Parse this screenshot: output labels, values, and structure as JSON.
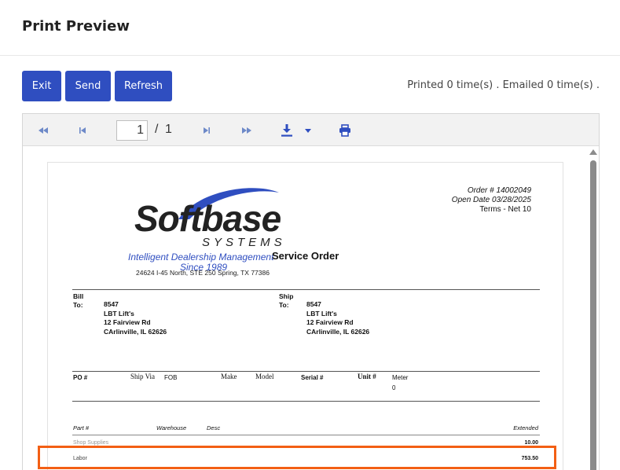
{
  "header": {
    "title": "Print Preview"
  },
  "actions": {
    "exit_label": "Exit",
    "send_label": "Send",
    "refresh_label": "Refresh"
  },
  "status": {
    "text": "Printed 0 time(s) . Emailed 0 time(s) ."
  },
  "viewer": {
    "current_page": "1",
    "separator": "/",
    "total_pages": "1",
    "icons": [
      "first-page-icon",
      "previous-page-icon",
      "next-page-icon",
      "last-page-icon",
      "download-icon",
      "dropdown-arrow-icon",
      "printer-icon"
    ]
  },
  "document": {
    "logo_text": "Softbase",
    "logo_sub": "SYSTEMS",
    "logo_tagline": "Intelligent Dealership Management",
    "logo_since": "Since 1989",
    "company_address": "24624 I-45 North, STE 250 Spring, TX 77386",
    "doc_title": "Service Order",
    "order_number": "Order # 14002049",
    "open_date": "Open Date 03/28/2025",
    "terms": "Terms - Net 10",
    "bill_label_1": "Bill",
    "bill_label_2": "To:",
    "bill_to": {
      "id": "8547",
      "name": "LBT Lift's",
      "street": "12 Fairview Rd",
      "city": "CArlinville, IL 62626"
    },
    "ship_label_1": "Ship",
    "ship_label_2": "To:",
    "ship_to": {
      "id": "8547",
      "name": "LBT Lift's",
      "street": "12 Fairview Rd",
      "city": "CArlinville, IL 62626"
    },
    "headers": {
      "po": "PO #",
      "ship_via": "Ship Via",
      "fob": "FOB",
      "make": "Make",
      "model": "Model",
      "serial": "Serial #",
      "unit": "Unit #",
      "meter": "Meter",
      "meter_value": "0"
    },
    "line_headers": {
      "part": "Part #",
      "warehouse": "Warehouse",
      "desc": "Desc",
      "extended": "Extended"
    },
    "lines": [
      {
        "desc": "Shop Supplies",
        "extended": "10.00"
      },
      {
        "desc": "Labor",
        "extended": "753.50"
      }
    ]
  },
  "colors": {
    "accent": "#2f4ec0",
    "highlight": "#f35f14"
  }
}
